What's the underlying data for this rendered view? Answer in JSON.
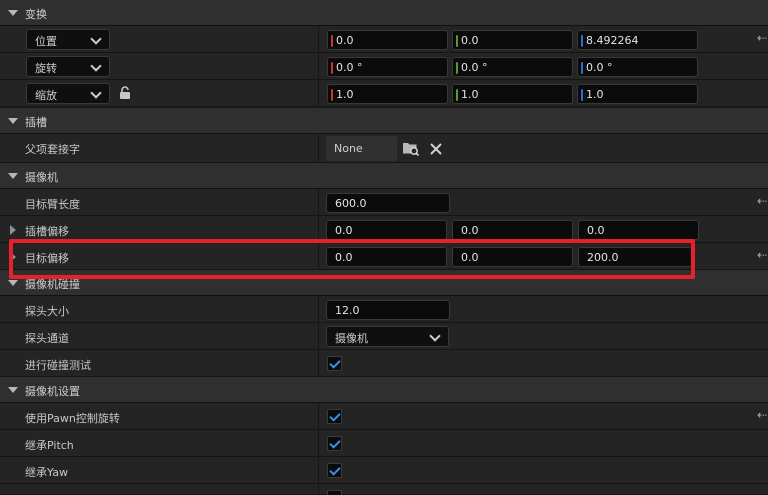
{
  "colors": {
    "x_axis": "#c0392b",
    "y_axis": "#5a9a2e",
    "z_axis": "#2f6fd0",
    "checkbox": "#3f8fe0",
    "highlight": "#e8202a"
  },
  "sections": {
    "transform": "变换",
    "socket": "插槽",
    "camera": "摄像机",
    "camera_collision": "摄像机碰撞",
    "camera_settings": "摄像机设置"
  },
  "transform": {
    "location": {
      "label": "位置",
      "x": "0.0",
      "y": "0.0",
      "z": "8.492264"
    },
    "rotation": {
      "label": "旋转",
      "x": "0.0 °",
      "y": "0.0 °",
      "z": "0.0 °"
    },
    "scale": {
      "label": "缩放",
      "x": "1.0",
      "y": "1.0",
      "z": "1.0"
    }
  },
  "socket": {
    "parent_socket_label": "父项套接字",
    "parent_socket_value": "None"
  },
  "camera": {
    "arm_length_label": "目标臂长度",
    "arm_length_value": "600.0",
    "socket_offset_label": "插槽偏移",
    "socket_offset": [
      "0.0",
      "0.0",
      "0.0"
    ],
    "target_offset_label": "目标偏移",
    "target_offset": [
      "0.0",
      "0.0",
      "200.0"
    ]
  },
  "collision": {
    "probe_size_label": "探头大小",
    "probe_size_value": "12.0",
    "probe_channel_label": "探头通道",
    "probe_channel_value": "摄像机",
    "do_collision_test_label": "进行碰撞测试",
    "do_collision_test": true
  },
  "camera_settings": {
    "use_pawn_control_rotation_label": "使用Pawn控制旋转",
    "inherit_pitch_label": "继承Pitch",
    "inherit_yaw_label": "继承Yaw"
  },
  "icons": {
    "reset": "reset-arrow-icon",
    "lock": "lock-icon",
    "browse": "folder-search-icon",
    "clear": "close-icon"
  }
}
